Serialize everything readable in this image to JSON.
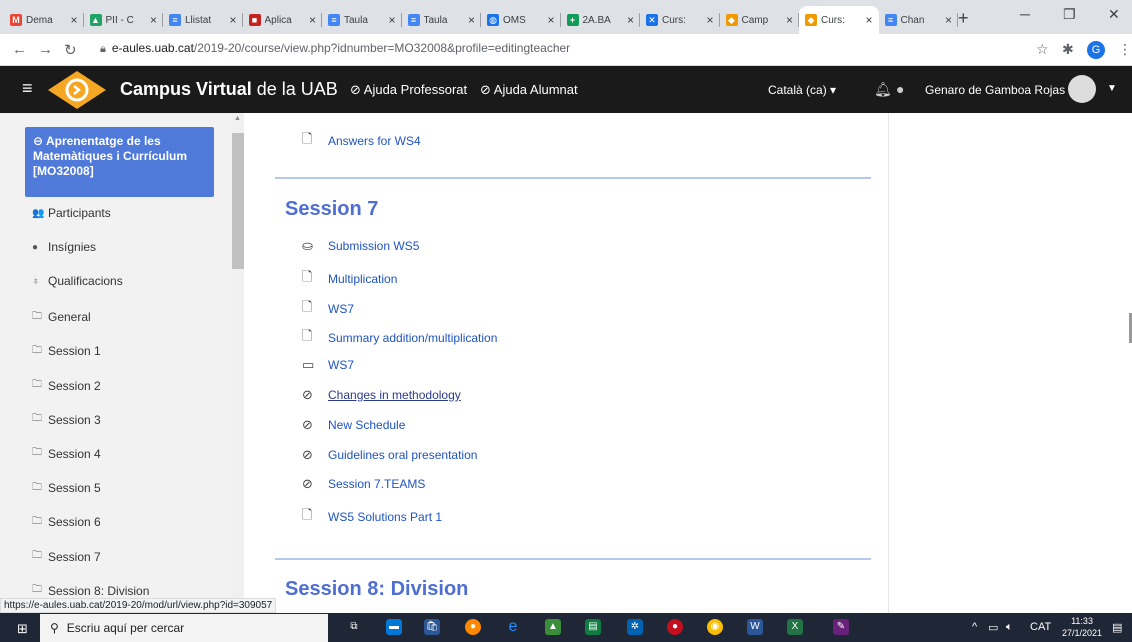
{
  "browser": {
    "tabs": [
      {
        "label": "Dema",
        "fav": "M",
        "color": "#ea4335"
      },
      {
        "label": "PII - C",
        "fav": "▲",
        "color": "#1fa463"
      },
      {
        "label": "Llistat",
        "fav": "≡",
        "color": "#4285f4"
      },
      {
        "label": "Aplica",
        "fav": "■",
        "color": "#c5221f"
      },
      {
        "label": "Taula",
        "fav": "≡",
        "color": "#4285f4"
      },
      {
        "label": "Taula",
        "fav": "≡",
        "color": "#4285f4"
      },
      {
        "label": "OMS",
        "fav": "◍",
        "color": "#1a73e8"
      },
      {
        "label": "2A.BA",
        "fav": "+",
        "color": "#0f9d58"
      },
      {
        "label": "Curs:",
        "fav": "✕",
        "color": "#1a73e8"
      },
      {
        "label": "Camp",
        "fav": "◆",
        "color": "#f29900"
      },
      {
        "label": "Curs:",
        "fav": "◆",
        "color": "#f29900"
      },
      {
        "label": "Chan",
        "fav": "≡",
        "color": "#4285f4"
      }
    ],
    "new_tab": "+",
    "url_host": "e-aules.uab.cat",
    "url_rest": "/2019-20/course/view.php?idnumber=MO32008&profile=editingteacher",
    "profile_initial": "G",
    "status_url": "https://e-aules.uab.cat/2019-20/mod/url/view.php?id=309057"
  },
  "navbar": {
    "brand_bold": "Campus Virtual",
    "brand_rest": " de la UAB",
    "help_prof": "⊘ Ajuda Professorat",
    "help_alum": "⊘ Ajuda Alumnat",
    "language": "Català (ca) ▾",
    "user": "Genaro de Gamboa Rojas"
  },
  "sidebar": {
    "course": "⊖ Aprenentatge de les Matemàtiques i Currículum [MO32008]",
    "items": [
      {
        "icon": "👥",
        "label": "Participants"
      },
      {
        "icon": "●",
        "label": "Insígnies"
      },
      {
        "icon": "♁",
        "label": "Qualificacions"
      },
      {
        "icon": "🗀",
        "label": "General"
      },
      {
        "icon": "🗀",
        "label": "Session 1"
      },
      {
        "icon": "🗀",
        "label": "Session 2"
      },
      {
        "icon": "🗀",
        "label": "Session 3"
      },
      {
        "icon": "🗀",
        "label": "Session 4"
      },
      {
        "icon": "🗀",
        "label": "Session 5"
      },
      {
        "icon": "🗀",
        "label": "Session 6"
      },
      {
        "icon": "🗀",
        "label": "Session 7"
      },
      {
        "icon": "🗀",
        "label": "Session 8: Division"
      }
    ]
  },
  "main": {
    "prev_activity": "Answers for WS4",
    "session7_title": "Session 7",
    "session7_activities": [
      {
        "icon": "assign-icon",
        "label": "Submission WS5"
      },
      {
        "icon": "file-icon",
        "label": "Multiplication"
      },
      {
        "icon": "file-icon",
        "label": "WS7"
      },
      {
        "icon": "file-icon",
        "label": "Summary addition/multiplication"
      },
      {
        "icon": "quiz-icon",
        "label": "WS7"
      },
      {
        "icon": "url-icon",
        "label": "Changes in methodology"
      },
      {
        "icon": "url-icon",
        "label": "New Schedule"
      },
      {
        "icon": "url-icon",
        "label": "Guidelines oral presentation"
      },
      {
        "icon": "url-icon",
        "label": "Session 7.TEAMS"
      },
      {
        "icon": "file-icon",
        "label": "WS5 Solutions Part 1"
      }
    ],
    "session8_title": "Session 8: Division"
  },
  "taskbar": {
    "search_placeholder": "Escriu aquí per cercar",
    "language": "CAT",
    "time": "11:33",
    "date": "27/1/2021"
  }
}
